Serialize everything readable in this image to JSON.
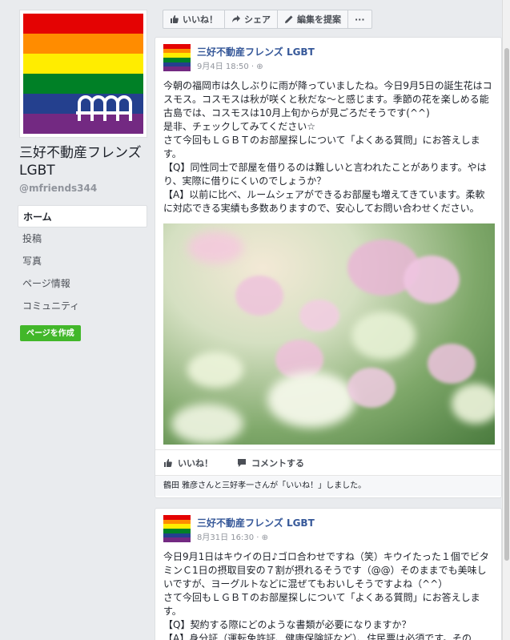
{
  "page": {
    "name": "三好不動産フレンズ LGBT",
    "handle": "@mfriends344",
    "flag_colors": [
      "#e40303",
      "#ff8c00",
      "#ffed00",
      "#008026",
      "#24408e",
      "#732982"
    ]
  },
  "left_nav": {
    "items": [
      {
        "label": "ホーム",
        "active": true
      },
      {
        "label": "投稿"
      },
      {
        "label": "写真"
      },
      {
        "label": "ページ情報"
      },
      {
        "label": "コミュニティ"
      }
    ],
    "create_page_label": "ページを作成"
  },
  "actionbar": {
    "like": "いいね！",
    "share": "シェア",
    "suggest_edit": "編集を提案",
    "more": "···"
  },
  "posts": [
    {
      "author": "三好不動産フレンズ LGBT",
      "meta": "9月4日 18:50 · ⊕",
      "text": "今朝の福岡市は久しぶりに雨が降っていましたね。今日9月5日の誕生花はコスモス。コスモスは秋が咲くと秋だな〜と感じます。季節の花を楽しめる能古島では、コスモスは10月上旬からが見ごろだそうです(^^)\n是非、チェックしてみてください☆\nさて今回もＬＧＢＴのお部屋探しについて「よくある質問」にお答えします。\n【Q】同性同士で部屋を借りるのは難しいと言われたことがあります。やはり、実際に借りにくいのでしょうか？\n【A】以前に比べ、ルームシェアができるお部屋も増えてきています。柔軟に対応できる実績も多数ありますので、安心してお問い合わせください。",
      "like_label": "いいね！",
      "comment_label": "コメントする",
      "likes_text": "鶴田 雅彦さんと三好孝一さんが「いいね！」しました。"
    },
    {
      "author": "三好不動産フレンズ LGBT",
      "meta": "8月31日 16:30 · ⊕",
      "text": "今日9月1日はキウイの日♪ゴロ合わせですね（笑）キウイたった１個でビタミンＣ1日の摂取目安の７割が摂れるそうです（@@）そのままでも美味しいですが、ヨーグルトなどに混ぜてもおいしそうですよね（^^）\nさて今回もＬＧＢＴのお部屋探しについて「よくある質問」にお答えします。\n【Q】契約する際にどのような書類が必要になりますか？\n【A】身分証（運転免許証、健康保険証など）、住民票は必須です。その"
    }
  ]
}
